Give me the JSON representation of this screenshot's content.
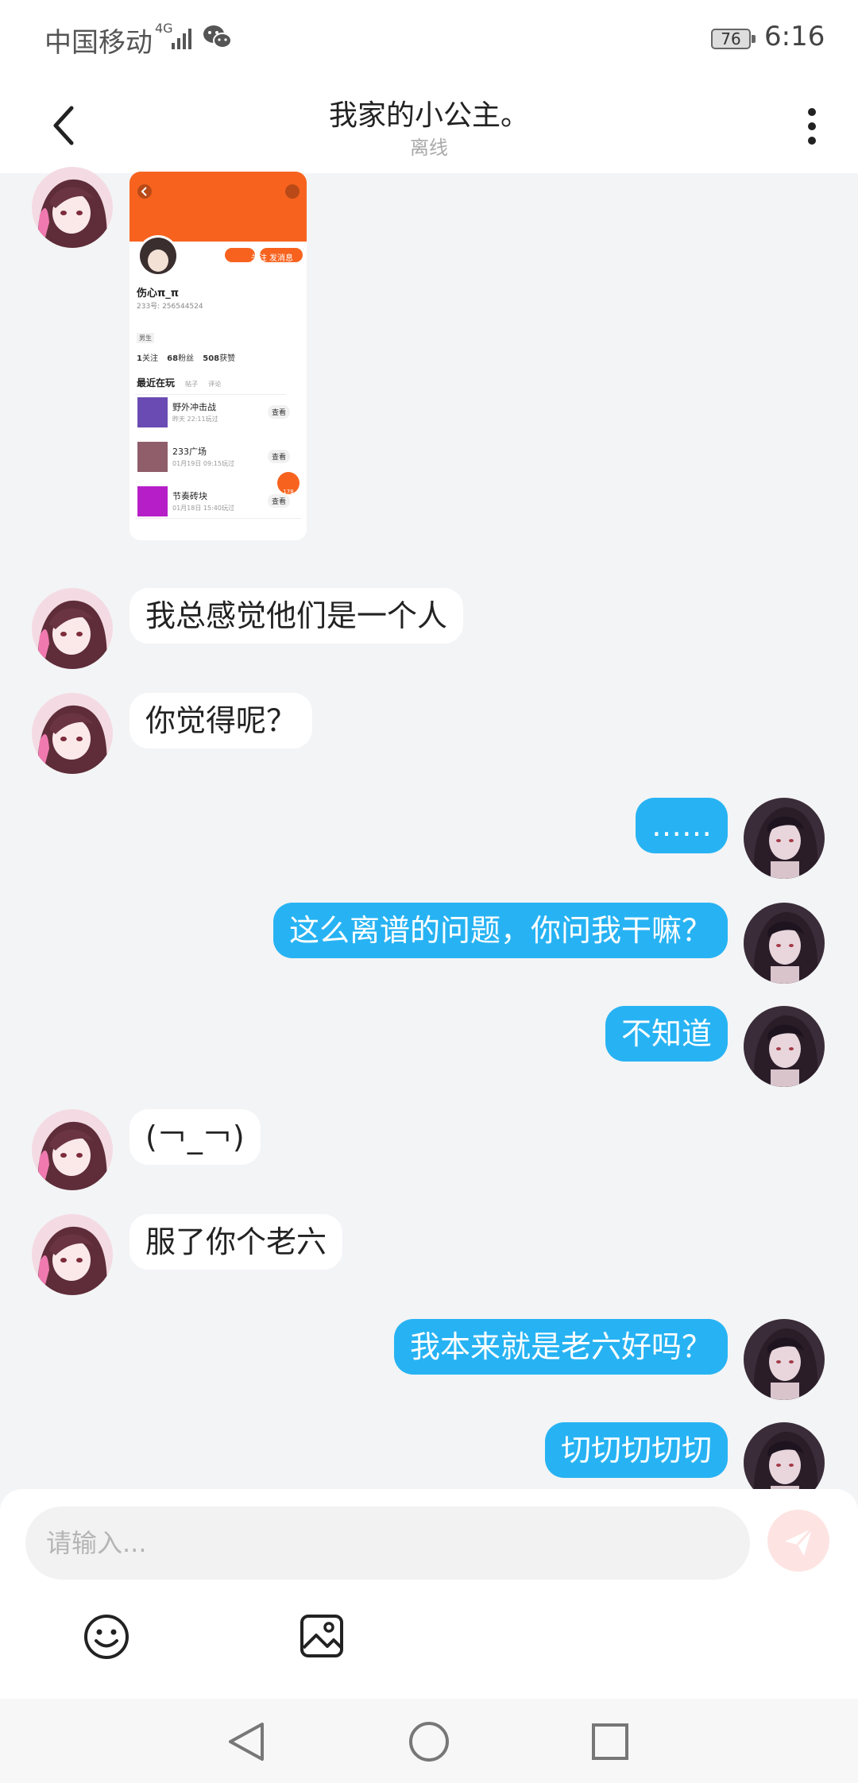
{
  "status_bar": {
    "carrier": "中国移动",
    "network": "4G",
    "battery": "76",
    "time": "6:16"
  },
  "header": {
    "title": "我家的小公主。",
    "status": "离线"
  },
  "shared_screenshot": {
    "profile_name": "伤心π_π",
    "profile_id": "233号: 256544524",
    "gender_tag": "男生",
    "follow_label": "关注",
    "message_label": "发消息",
    "stats": {
      "follows": "1",
      "follows_label": "关注",
      "fans": "68",
      "fans_label": "粉丝",
      "likes": "508",
      "likes_label": "获赞"
    },
    "tabs": [
      "最近在玩",
      "帖子",
      "评论"
    ],
    "games": [
      {
        "name": "野外冲击战",
        "time": "昨天 22:11玩过",
        "action": "查看"
      },
      {
        "name": "233广场",
        "time": "01月19日 09:15玩过",
        "action": "查看"
      },
      {
        "name": "节奏砖块",
        "time": "01月18日 15:40玩过",
        "action": "查看"
      }
    ],
    "heart_count": "178"
  },
  "messages": [
    {
      "side": "left",
      "text": "我总感觉他们是一个人"
    },
    {
      "side": "left",
      "text": "你觉得呢？"
    },
    {
      "side": "right",
      "text": "……"
    },
    {
      "side": "right",
      "text": "这么离谱的问题，你问我干嘛？"
    },
    {
      "side": "right",
      "text": "不知道"
    },
    {
      "side": "left",
      "text": "(￢_￢)"
    },
    {
      "side": "left",
      "text": "服了你个老六"
    },
    {
      "side": "right",
      "text": "我本来就是老六好吗？"
    },
    {
      "side": "right",
      "text": "切切切切切"
    }
  ],
  "input": {
    "placeholder": "请输入..."
  },
  "colors": {
    "bubble_right": "#27b3f3",
    "bubble_left": "#ffffff",
    "background": "#f3f4f6",
    "screenshot_orange": "#f7631f",
    "send_button": "#fde4e2"
  },
  "icons": {
    "back": "chevron-left-icon",
    "more": "more-vertical-icon",
    "send": "send-icon",
    "emoji": "smiley-icon",
    "image": "image-icon",
    "nav_back": "triangle-back-icon",
    "nav_home": "circle-home-icon",
    "nav_recent": "square-recent-icon"
  }
}
